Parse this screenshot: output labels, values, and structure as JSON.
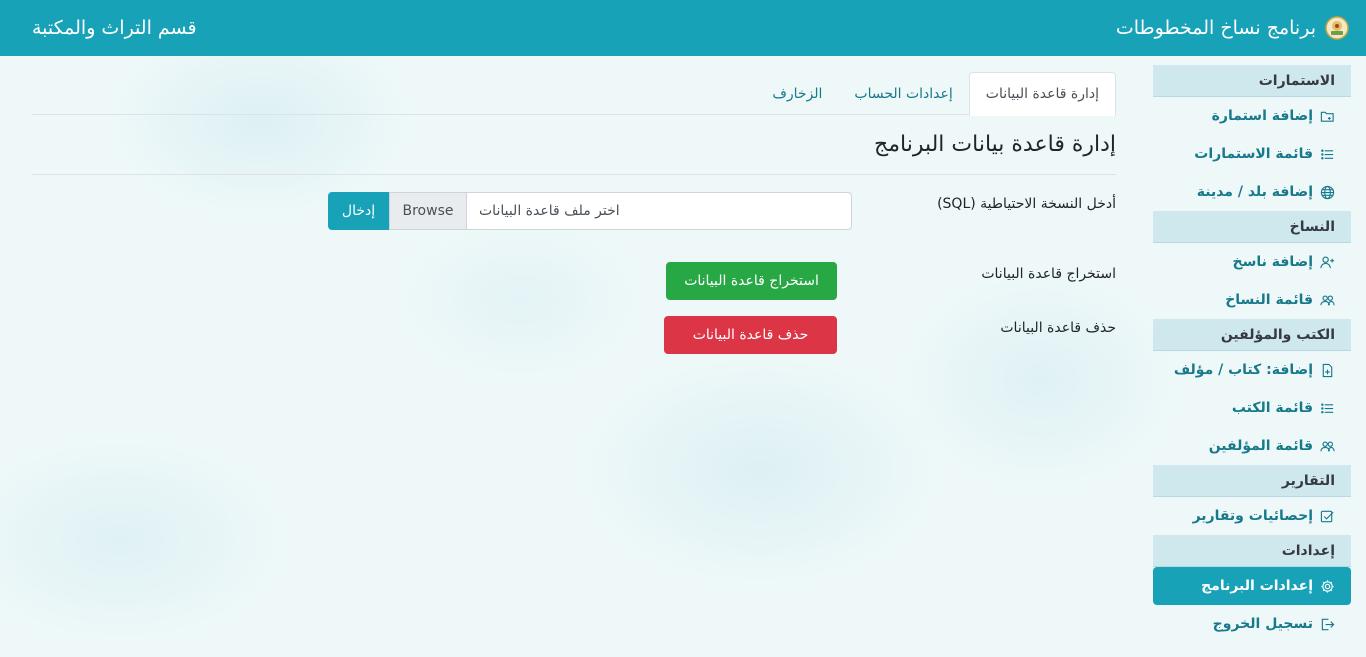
{
  "header": {
    "app_title": "برنامج نساخ المخطوطات",
    "department": "قسم التراث والمكتبة",
    "logo_icon": "emblem-icon"
  },
  "sidebar": {
    "sections": [
      {
        "title": "الاستمارات",
        "items": [
          {
            "label": "إضافة استمارة",
            "icon": "folder-plus-icon"
          },
          {
            "label": "قائمة الاستمارات",
            "icon": "list-icon"
          },
          {
            "label": "إضافة بلد / مدينة",
            "icon": "globe-icon"
          }
        ]
      },
      {
        "title": "النساخ",
        "items": [
          {
            "label": "إضافة ناسخ",
            "icon": "user-plus-icon"
          },
          {
            "label": "قائمة النساخ",
            "icon": "users-icon"
          }
        ]
      },
      {
        "title": "الكتب والمؤلفين",
        "items": [
          {
            "label": "إضافة: كتاب / مؤلف",
            "icon": "file-plus-icon"
          },
          {
            "label": "قائمة الكتب",
            "icon": "list-icon"
          },
          {
            "label": "قائمة المؤلفين",
            "icon": "users-icon"
          }
        ]
      },
      {
        "title": "التقارير",
        "items": [
          {
            "label": "إحصائيات وتقارير",
            "icon": "check-square-icon"
          }
        ]
      },
      {
        "title": "إعدادات",
        "items": [
          {
            "label": "إعدادات البرنامج",
            "icon": "gear-icon",
            "active": true
          },
          {
            "label": "تسجيل الخروج",
            "icon": "logout-icon"
          }
        ]
      }
    ]
  },
  "tabs": [
    {
      "label": "إدارة قاعدة البيانات",
      "active": true
    },
    {
      "label": "إعدادات الحساب"
    },
    {
      "label": "الزخارف"
    }
  ],
  "main": {
    "page_title": "إدارة قاعدة بيانات البرنامج",
    "backup_label": "أدخل النسخة الاحتياطية (SQL)",
    "file_placeholder": "اختر ملف قاعدة البيانات",
    "browse_label": "Browse",
    "enter_label": "إدخال",
    "extract_label": "استخراج قاعدة البيانات",
    "extract_button": "استخراج قاعدة البيانات",
    "delete_label": "حذف قاعدة البيانات",
    "delete_button": "حذف قاعدة البيانات"
  },
  "colors": {
    "primary": "#17a2b8",
    "success": "#28a745",
    "danger": "#dc3545",
    "section_bg": "#cfe8ed"
  }
}
